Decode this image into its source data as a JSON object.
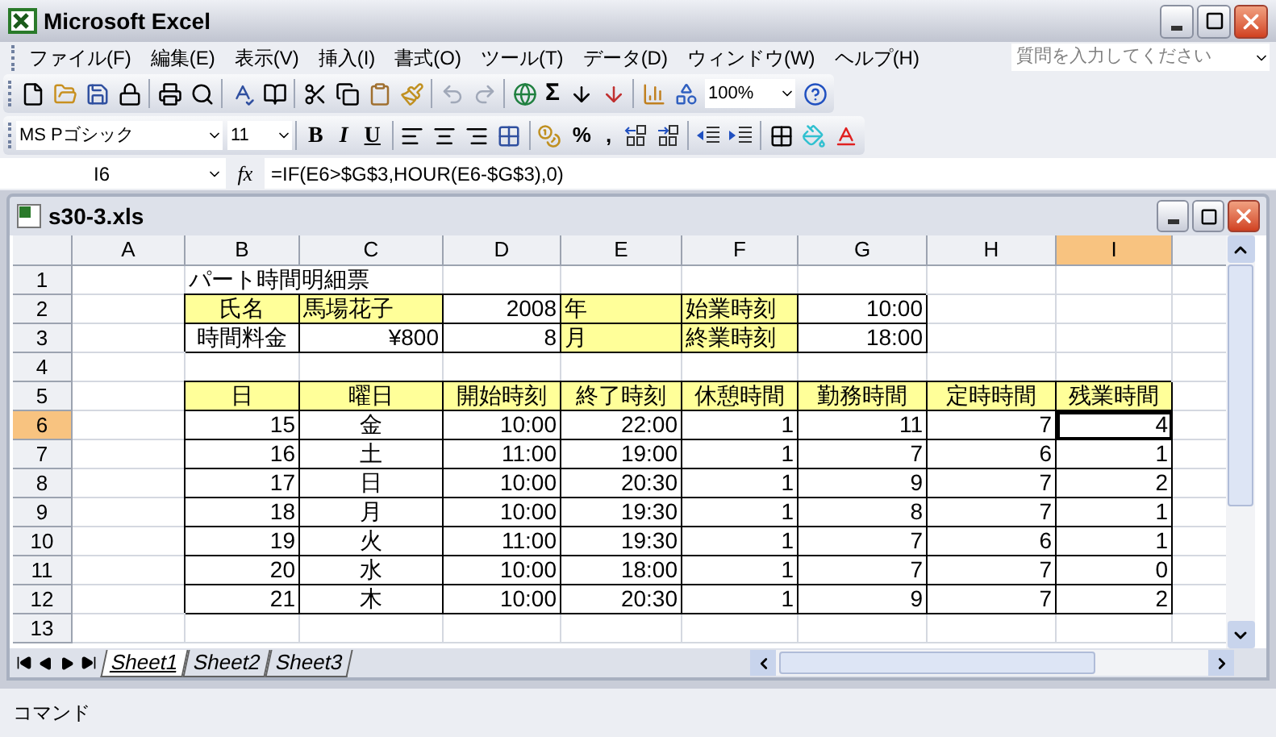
{
  "window": {
    "title": "Microsoft Excel"
  },
  "menu": [
    "ファイル(F)",
    "編集(E)",
    "表示(V)",
    "挿入(I)",
    "書式(O)",
    "ツール(T)",
    "データ(D)",
    "ウィンドウ(W)",
    "ヘルプ(H)"
  ],
  "help_search": {
    "placeholder": "質問を入力してください"
  },
  "standard_toolbar": {
    "autosum": "Σ",
    "zoom": "100%"
  },
  "formatting_toolbar": {
    "font": "MS Pゴシック",
    "size": "11",
    "bold": "B",
    "italic": "I",
    "underline": "U",
    "percent": "%",
    "comma": ","
  },
  "formula_bar": {
    "name_box": "I6",
    "function_label": "fx",
    "formula": "=IF(E6>$G$3,HOUR(E6-$G$3),0)"
  },
  "workbook": {
    "title": "s30-3.xls",
    "columns": [
      {
        "label": "A",
        "selected": false
      },
      {
        "label": "B",
        "selected": false
      },
      {
        "label": "C",
        "selected": false
      },
      {
        "label": "D",
        "selected": false
      },
      {
        "label": "E",
        "selected": false
      },
      {
        "label": "F",
        "selected": false
      },
      {
        "label": "G",
        "selected": false
      },
      {
        "label": "H",
        "selected": false
      },
      {
        "label": "I",
        "selected": true
      }
    ],
    "rows": [
      {
        "header": "1",
        "selected": false,
        "cells": [
          {
            "kind": "plain"
          },
          {
            "kind": "plain",
            "text": "パート時間明細票"
          },
          {
            "kind": "plain"
          },
          {
            "kind": "plain"
          },
          {
            "kind": "plain"
          },
          {
            "kind": "plain"
          },
          {
            "kind": "plain"
          },
          {
            "kind": "plain"
          },
          {
            "kind": "plain"
          }
        ]
      },
      {
        "header": "2",
        "selected": false,
        "cells": [
          {
            "kind": "plain"
          },
          {
            "kind": "label",
            "text": "氏名",
            "centered": true
          },
          {
            "kind": "label",
            "text": "馬場花子"
          },
          {
            "kind": "boxed",
            "text": "2008",
            "right_aligned": true
          },
          {
            "kind": "label",
            "text": "年"
          },
          {
            "kind": "label",
            "text": "始業時刻"
          },
          {
            "kind": "boxed",
            "text": "10:00",
            "right_aligned": true
          },
          {
            "kind": "plain"
          },
          {
            "kind": "plain"
          }
        ]
      },
      {
        "header": "3",
        "selected": false,
        "cells": [
          {
            "kind": "plain"
          },
          {
            "kind": "boxed",
            "text": "時間料金",
            "centered": true
          },
          {
            "kind": "boxed",
            "text": "¥800",
            "right_aligned": true
          },
          {
            "kind": "boxed",
            "text": "8",
            "right_aligned": true
          },
          {
            "kind": "label",
            "text": "月"
          },
          {
            "kind": "label",
            "text": "終業時刻"
          },
          {
            "kind": "boxed",
            "text": "18:00",
            "right_aligned": true
          },
          {
            "kind": "plain"
          },
          {
            "kind": "plain"
          }
        ]
      },
      {
        "header": "4",
        "selected": false,
        "cells": [
          {
            "kind": "plain"
          },
          {
            "kind": "plain"
          },
          {
            "kind": "plain"
          },
          {
            "kind": "plain"
          },
          {
            "kind": "plain"
          },
          {
            "kind": "plain"
          },
          {
            "kind": "plain"
          },
          {
            "kind": "plain"
          },
          {
            "kind": "plain"
          }
        ]
      },
      {
        "header": "5",
        "selected": false,
        "cells": [
          {
            "kind": "plain"
          },
          {
            "kind": "label",
            "text": "日",
            "centered": true
          },
          {
            "kind": "label",
            "text": "曜日",
            "centered": true
          },
          {
            "kind": "label",
            "text": "開始時刻",
            "centered": true
          },
          {
            "kind": "label",
            "text": "終了時刻",
            "centered": true
          },
          {
            "kind": "label",
            "text": "休憩時間",
            "centered": true
          },
          {
            "kind": "label",
            "text": "勤務時間",
            "centered": true
          },
          {
            "kind": "label",
            "text": "定時時間",
            "centered": true
          },
          {
            "kind": "label",
            "text": "残業時間",
            "centered": true
          }
        ]
      },
      {
        "header": "6",
        "selected": true,
        "cells": [
          {
            "kind": "plain"
          },
          {
            "kind": "boxed",
            "text": "15",
            "right_aligned": true
          },
          {
            "kind": "boxed",
            "text": "金",
            "centered": true
          },
          {
            "kind": "boxed",
            "text": "10:00",
            "right_aligned": true
          },
          {
            "kind": "boxed",
            "text": "22:00",
            "right_aligned": true
          },
          {
            "kind": "boxed",
            "text": "1",
            "right_aligned": true
          },
          {
            "kind": "boxed",
            "text": "11",
            "right_aligned": true
          },
          {
            "kind": "boxed",
            "text": "7",
            "right_aligned": true
          },
          {
            "kind": "boxed",
            "text": "4",
            "right_aligned": true
          }
        ]
      },
      {
        "header": "7",
        "selected": false,
        "cells": [
          {
            "kind": "plain"
          },
          {
            "kind": "boxed",
            "text": "16",
            "right_aligned": true
          },
          {
            "kind": "boxed",
            "text": "土",
            "centered": true
          },
          {
            "kind": "boxed",
            "text": "11:00",
            "right_aligned": true
          },
          {
            "kind": "boxed",
            "text": "19:00",
            "right_aligned": true
          },
          {
            "kind": "boxed",
            "text": "1",
            "right_aligned": true
          },
          {
            "kind": "boxed",
            "text": "7",
            "right_aligned": true
          },
          {
            "kind": "boxed",
            "text": "6",
            "right_aligned": true
          },
          {
            "kind": "boxed",
            "text": "1",
            "right_aligned": true
          }
        ]
      },
      {
        "header": "8",
        "selected": false,
        "cells": [
          {
            "kind": "plain"
          },
          {
            "kind": "boxed",
            "text": "17",
            "right_aligned": true
          },
          {
            "kind": "boxed",
            "text": "日",
            "centered": true
          },
          {
            "kind": "boxed",
            "text": "10:00",
            "right_aligned": true
          },
          {
            "kind": "boxed",
            "text": "20:30",
            "right_aligned": true
          },
          {
            "kind": "boxed",
            "text": "1",
            "right_aligned": true
          },
          {
            "kind": "boxed",
            "text": "9",
            "right_aligned": true
          },
          {
            "kind": "boxed",
            "text": "7",
            "right_aligned": true
          },
          {
            "kind": "boxed",
            "text": "2",
            "right_aligned": true
          }
        ]
      },
      {
        "header": "9",
        "selected": false,
        "cells": [
          {
            "kind": "plain"
          },
          {
            "kind": "boxed",
            "text": "18",
            "right_aligned": true
          },
          {
            "kind": "boxed",
            "text": "月",
            "centered": true
          },
          {
            "kind": "boxed",
            "text": "10:00",
            "right_aligned": true
          },
          {
            "kind": "boxed",
            "text": "19:30",
            "right_aligned": true
          },
          {
            "kind": "boxed",
            "text": "1",
            "right_aligned": true
          },
          {
            "kind": "boxed",
            "text": "8",
            "right_aligned": true
          },
          {
            "kind": "boxed",
            "text": "7",
            "right_aligned": true
          },
          {
            "kind": "boxed",
            "text": "1",
            "right_aligned": true
          }
        ]
      },
      {
        "header": "10",
        "selected": false,
        "cells": [
          {
            "kind": "plain"
          },
          {
            "kind": "boxed",
            "text": "19",
            "right_aligned": true
          },
          {
            "kind": "boxed",
            "text": "火",
            "centered": true
          },
          {
            "kind": "boxed",
            "text": "11:00",
            "right_aligned": true
          },
          {
            "kind": "boxed",
            "text": "19:30",
            "right_aligned": true
          },
          {
            "kind": "boxed",
            "text": "1",
            "right_aligned": true
          },
          {
            "kind": "boxed",
            "text": "7",
            "right_aligned": true
          },
          {
            "kind": "boxed",
            "text": "6",
            "right_aligned": true
          },
          {
            "kind": "boxed",
            "text": "1",
            "right_aligned": true
          }
        ]
      },
      {
        "header": "11",
        "selected": false,
        "cells": [
          {
            "kind": "plain"
          },
          {
            "kind": "boxed",
            "text": "20",
            "right_aligned": true
          },
          {
            "kind": "boxed",
            "text": "水",
            "centered": true
          },
          {
            "kind": "boxed",
            "text": "10:00",
            "right_aligned": true
          },
          {
            "kind": "boxed",
            "text": "18:00",
            "right_aligned": true
          },
          {
            "kind": "boxed",
            "text": "1",
            "right_aligned": true
          },
          {
            "kind": "boxed",
            "text": "7",
            "right_aligned": true
          },
          {
            "kind": "boxed",
            "text": "7",
            "right_aligned": true
          },
          {
            "kind": "boxed",
            "text": "0",
            "right_aligned": true
          }
        ]
      },
      {
        "header": "12",
        "selected": false,
        "cells": [
          {
            "kind": "plain"
          },
          {
            "kind": "boxed",
            "text": "21",
            "right_aligned": true
          },
          {
            "kind": "boxed",
            "text": "木",
            "centered": true
          },
          {
            "kind": "boxed",
            "text": "10:00",
            "right_aligned": true
          },
          {
            "kind": "boxed",
            "text": "20:30",
            "right_aligned": true
          },
          {
            "kind": "boxed",
            "text": "1",
            "right_aligned": true
          },
          {
            "kind": "boxed",
            "text": "9",
            "right_aligned": true
          },
          {
            "kind": "boxed",
            "text": "7",
            "right_aligned": true
          },
          {
            "kind": "boxed",
            "text": "2",
            "right_aligned": true
          }
        ]
      },
      {
        "header": "13",
        "selected": false,
        "cells": [
          {
            "kind": "plain"
          },
          {
            "kind": "plain"
          },
          {
            "kind": "plain"
          },
          {
            "kind": "plain"
          },
          {
            "kind": "plain"
          },
          {
            "kind": "plain"
          },
          {
            "kind": "plain"
          },
          {
            "kind": "plain"
          },
          {
            "kind": "plain"
          }
        ]
      }
    ],
    "sheets": [
      {
        "label": "Sheet1",
        "selected": true
      },
      {
        "label": "Sheet2",
        "selected": false
      },
      {
        "label": "Sheet3",
        "selected": false
      }
    ]
  },
  "status_bar": {
    "text": "コマンド"
  }
}
